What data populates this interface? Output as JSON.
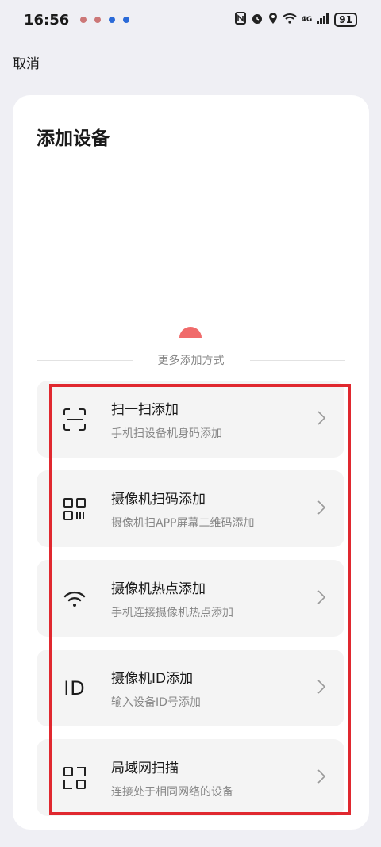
{
  "status_bar": {
    "time": "16:56",
    "network": "4G",
    "battery": "91"
  },
  "header": {
    "cancel_label": "取消"
  },
  "card": {
    "title": "添加设备",
    "more_methods_label": "更多添加方式",
    "methods": [
      {
        "title": "扫一扫添加",
        "subtitle": "手机扫设备机身码添加",
        "icon": "scan-icon"
      },
      {
        "title": "摄像机扫码添加",
        "subtitle": "摄像机扫APP屏幕二维码添加",
        "icon": "qr-code-icon"
      },
      {
        "title": "摄像机热点添加",
        "subtitle": "手机连接摄像机热点添加",
        "icon": "wifi-icon"
      },
      {
        "title": "摄像机ID添加",
        "subtitle": "输入设备ID号添加",
        "icon": "id-icon"
      },
      {
        "title": "局域网扫描",
        "subtitle": "连接处于相同网络的设备",
        "icon": "lan-icon"
      }
    ],
    "id_icon_text": "ID"
  },
  "colors": {
    "background": "#efeff4",
    "card": "#ffffff",
    "method_bg": "#f4f4f4",
    "highlight": "#e0282f",
    "accent_dot": "#f06b6b"
  }
}
